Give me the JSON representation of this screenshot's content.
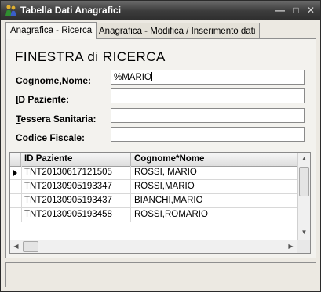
{
  "window": {
    "title": "Tabella Dati Anagrafici",
    "buttons": {
      "minimize": "—",
      "maximize": "□",
      "close": "✕"
    }
  },
  "tabs": [
    {
      "label": "Anagrafica - Ricerca",
      "active": true
    },
    {
      "label": "Anagrafica - Modifica / Inserimento dati",
      "active": false
    }
  ],
  "search": {
    "heading": "FINESTRA di RICERCA",
    "fields": [
      {
        "label_pre": "Cognome",
        "label_accel": ",",
        "label_post": "Nome:",
        "value": "%MARIO"
      },
      {
        "label_pre": "",
        "label_accel": "I",
        "label_post": "D Paziente:",
        "value": ""
      },
      {
        "label_pre": "",
        "label_accel": "T",
        "label_post": "essera Sanitaria:",
        "value": ""
      },
      {
        "label_pre": "Codice ",
        "label_accel": "F",
        "label_post": "iscale:",
        "value": ""
      }
    ]
  },
  "grid": {
    "columns": [
      "ID Paziente",
      "Cognome*Nome"
    ],
    "rows": [
      {
        "id": "TNT20130617121505",
        "name": "ROSSI, MARIO",
        "current": true
      },
      {
        "id": "TNT20130905193347",
        "name": "ROSSI,MARIO",
        "current": false
      },
      {
        "id": "TNT20130905193437",
        "name": "BIANCHI,MARIO",
        "current": false
      },
      {
        "id": "TNT20130905193458",
        "name": "ROSSI,ROMARIO",
        "current": false
      }
    ]
  },
  "icons": {
    "scroll_up": "▲",
    "scroll_down": "▼",
    "scroll_left": "◀",
    "scroll_right": "▶"
  }
}
